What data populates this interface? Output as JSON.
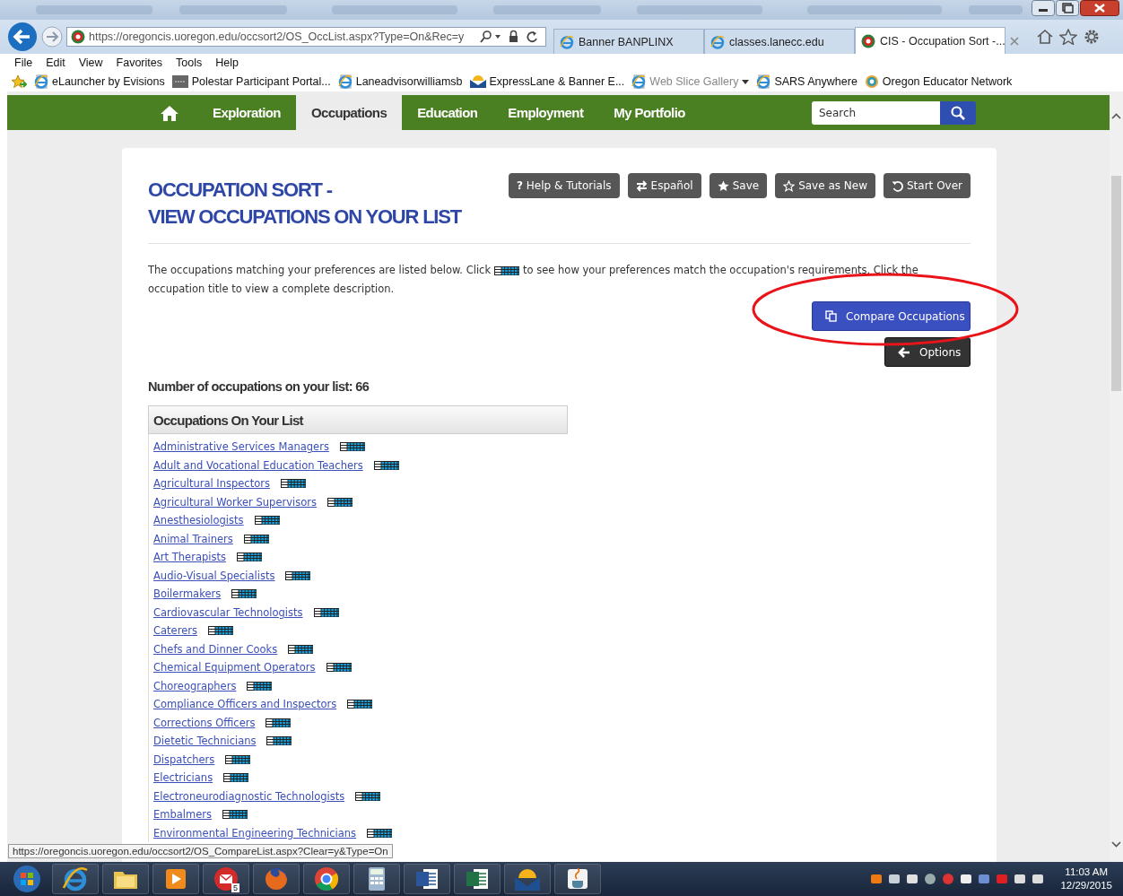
{
  "browser": {
    "address": "https://oregoncis.uoregon.edu/occsort2/OS_OccList.aspx?Type=On&Rec=y",
    "tabs": [
      {
        "label": "Banner BANPLINX",
        "selected": false
      },
      {
        "label": "classes.lanecc.edu",
        "selected": false
      },
      {
        "label": "CIS - Occupation Sort -...",
        "selected": true
      }
    ],
    "menu": [
      "File",
      "Edit",
      "View",
      "Favorites",
      "Tools",
      "Help"
    ],
    "favorites": [
      {
        "label": "eLauncher by Evisions",
        "kind": "page",
        "dimmed": false
      },
      {
        "label": "Polestar Participant Portal...",
        "kind": "portal",
        "dimmed": false
      },
      {
        "label": "Laneadvisorwilliamsb",
        "kind": "page",
        "dimmed": false
      },
      {
        "label": "ExpressLane & Banner  E...",
        "kind": "banner",
        "dimmed": false
      },
      {
        "label": "Web Slice Gallery",
        "kind": "page",
        "dimmed": true,
        "dropdown": true
      },
      {
        "label": "SARS Anywhere",
        "kind": "page",
        "dimmed": false
      },
      {
        "label": "Oregon Educator Network",
        "kind": "network",
        "dimmed": false
      }
    ]
  },
  "nav": {
    "items": [
      {
        "label": "Exploration",
        "selected": false
      },
      {
        "label": "Occupations",
        "selected": true
      },
      {
        "label": "Education",
        "selected": false
      },
      {
        "label": "Employment",
        "selected": false
      },
      {
        "label": "My Portfolio",
        "selected": false
      }
    ],
    "search": {
      "placeholder": "Search"
    }
  },
  "page": {
    "title_lines": [
      "OCCUPATION SORT -",
      "VIEW OCCUPATIONS ON YOUR LIST"
    ],
    "actions": [
      {
        "label": "Help & Tutorials",
        "kind": "help",
        "glyph": "?"
      },
      {
        "label": "Español",
        "kind": "swap"
      },
      {
        "label": "Save",
        "kind": "star"
      },
      {
        "label": "Save as New",
        "kind": "outline"
      },
      {
        "label": "Start Over",
        "kind": "undo"
      }
    ],
    "intro_start": "The occupations matching your preferences are listed below. Click",
    "intro_middle": "to see how your preferences match the occupation's requirements. Click the",
    "intro_end": "occupation title to view a complete description.",
    "compare_button": "Compare Occupations",
    "options_button": "Options",
    "count": "Number of occupations on your list: 66",
    "list_title": "Occupations On Your List",
    "occupations": [
      "Administrative Services Managers",
      "Adult and Vocational Education Teachers",
      "Agricultural Inspectors",
      "Agricultural Worker Supervisors",
      "Anesthesiologists",
      "Animal Trainers",
      "Art Therapists",
      "Audio-Visual Specialists",
      "Boilermakers",
      "Cardiovascular Technologists",
      "Caterers",
      "Chefs and Dinner Cooks",
      "Chemical Equipment Operators",
      "Choreographers",
      "Compliance Officers and Inspectors",
      "Corrections Officers",
      "Dietetic Technicians",
      "Dispatchers",
      "Electricians",
      "Electroneurodiagnostic Technologists",
      "Embalmers",
      "Environmental Engineering Technicians"
    ]
  },
  "annotation": {
    "kind": "ellipse"
  },
  "status_url": "https://oregoncis.uoregon.edu/occsort2/OS_CompareList.aspx?Clear=y&Type=On",
  "taskbar": {
    "apps": [
      {
        "kind": "start"
      },
      {
        "kind": "ie"
      },
      {
        "kind": "folder"
      },
      {
        "kind": "media"
      },
      {
        "kind": "mail",
        "badge": "5"
      },
      {
        "kind": "firefox"
      },
      {
        "kind": "chrome"
      },
      {
        "kind": "calculator"
      },
      {
        "kind": "word"
      },
      {
        "kind": "excel"
      },
      {
        "kind": "banner"
      },
      {
        "kind": "java"
      }
    ],
    "time": "11:03 AM",
    "date": "12/29/2015"
  }
}
